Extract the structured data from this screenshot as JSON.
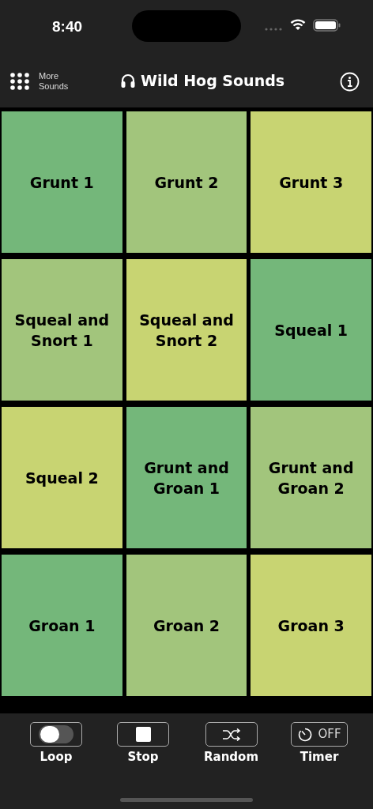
{
  "status_bar": {
    "time": "8:40"
  },
  "header": {
    "more_label": "More Sounds",
    "title": "Wild Hog Sounds"
  },
  "tiles": [
    {
      "label": "Grunt 1",
      "color": "#74b77a"
    },
    {
      "label": "Grunt 2",
      "color": "#a2c57c"
    },
    {
      "label": "Grunt 3",
      "color": "#c8d472"
    },
    {
      "label": "Squeal and Snort 1",
      "color": "#a2c57c"
    },
    {
      "label": "Squeal and Snort 2",
      "color": "#c8d472"
    },
    {
      "label": "Squeal 1",
      "color": "#74b77a"
    },
    {
      "label": "Squeal 2",
      "color": "#c8d472"
    },
    {
      "label": "Grunt and Groan 1",
      "color": "#74b77a"
    },
    {
      "label": "Grunt and Groan 2",
      "color": "#a2c57c"
    },
    {
      "label": "Groan 1",
      "color": "#74b77a"
    },
    {
      "label": "Groan 2",
      "color": "#a2c57c"
    },
    {
      "label": "Groan 3",
      "color": "#c8d472"
    }
  ],
  "toolbar": [
    {
      "kind": "toggle",
      "label": "Loop",
      "on": false
    },
    {
      "kind": "stop",
      "label": "Stop"
    },
    {
      "kind": "shuffle",
      "label": "Random"
    },
    {
      "kind": "timer",
      "label": "Timer",
      "value": "OFF"
    }
  ]
}
